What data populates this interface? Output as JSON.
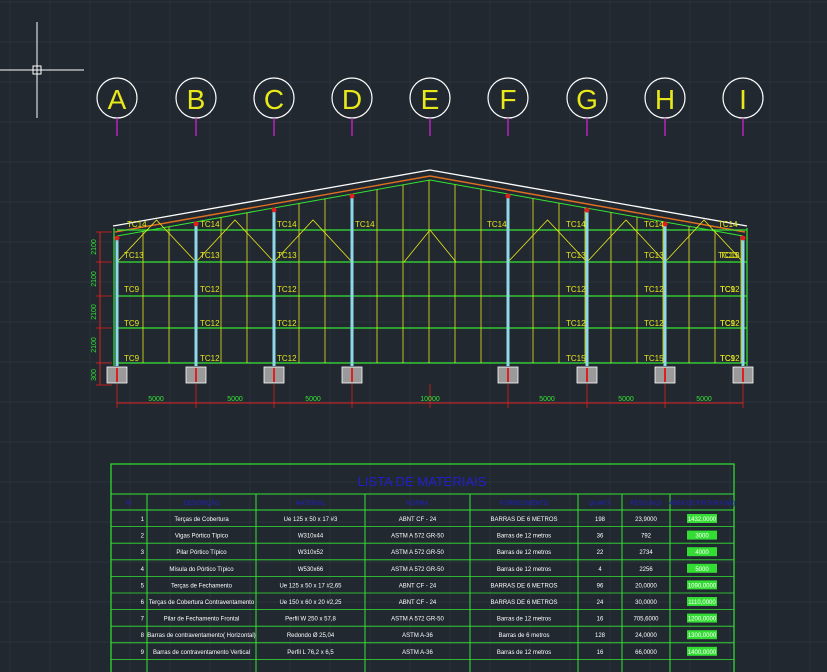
{
  "grid_axes": [
    "A",
    "B",
    "C",
    "D",
    "E",
    "F",
    "G",
    "H",
    "I"
  ],
  "member_labels": {
    "top_row": [
      "TC14",
      "TC14",
      "TC14",
      "TC14",
      "TC14",
      "TC14",
      "TC14",
      "TC14"
    ],
    "row2": [
      "TC13",
      "TC13",
      "TC13",
      "TC13",
      "TC13",
      "TC13",
      "TC13"
    ],
    "row3": [
      "TC9",
      "TC12",
      "TC12",
      "TC12",
      "TC12",
      "TC12",
      "TC9"
    ],
    "row4": [
      "TC9",
      "TC12",
      "TC12",
      "TC12",
      "TC12",
      "TC12",
      "TC9"
    ],
    "row5": [
      "TC9",
      "TC12",
      "TC12",
      "TC15",
      "TC15",
      "TC12",
      "TC9"
    ]
  },
  "vertical_dims": [
    "2100",
    "2100",
    "2100",
    "2100",
    "300"
  ],
  "span_dims": [
    "5000",
    "5000",
    "5000",
    "10000",
    "5000",
    "5000",
    "5000"
  ],
  "colors": {
    "background": "#212830",
    "grid": "#2b323c",
    "frame": "#33e533",
    "yellow": "#e8e81a",
    "column": "#8fd8e8",
    "magenta": "#e020e0",
    "red": "#e02020",
    "table_header": "#2020c8",
    "highlight": "#33dd33"
  },
  "table": {
    "title": "LISTA DE MATERIAIS",
    "headers": [
      "N°",
      "DESCRIÇÃO",
      "MATERIAL",
      "NORMA",
      "FORNECIMENTO",
      "QUANT.",
      "PESO (KG)",
      "ÁREA DE PINTURA (M²)"
    ],
    "rows": [
      {
        "n": "1",
        "desc": "Terças de Cobertura",
        "mat": "Ue 125 x 50 x 17 #3",
        "norma": "ABNT CF - 24",
        "forn": "BARRAS DE 6 METROS",
        "qtd": "198",
        "peso": "23,9000",
        "area": "1432,0000"
      },
      {
        "n": "2",
        "desc": "Vigas Pórtico Típico",
        "mat": "W310x44",
        "norma": "ASTM A 572 GR-50",
        "forn": "Barras de 12 metros",
        "qtd": "36",
        "peso": "792",
        "area": "3000"
      },
      {
        "n": "3",
        "desc": "Pilar Pórtico Típico",
        "mat": "W310x52",
        "norma": "ASTM A 572 GR-50",
        "forn": "Barras de 12 metros",
        "qtd": "22",
        "peso": "2734",
        "area": "4000"
      },
      {
        "n": "4",
        "desc": "Mísula do Pórtico Típico",
        "mat": "W530x66",
        "norma": "ASTM A 572 GR-50",
        "forn": "Barras de 12 metros",
        "qtd": "4",
        "peso": "2256",
        "area": "5000"
      },
      {
        "n": "5",
        "desc": "Terças de Fechamento",
        "mat": "Ue 125 x 50 x 17 #2,65",
        "norma": "ABNT CF - 24",
        "forn": "BARRAS DE 6 METROS",
        "qtd": "96",
        "peso": "20,0000",
        "area": "1090,0000"
      },
      {
        "n": "6",
        "desc": "Terças de Cobertura Contraventamento",
        "mat": "Ue 150 x 60 x 20 #2,25",
        "norma": "ABNT CF - 24",
        "forn": "BARRAS DE 6 METROS",
        "qtd": "24",
        "peso": "30,0000",
        "area": "1110,0000"
      },
      {
        "n": "7",
        "desc": "Pilar de Fechamento Frontal",
        "mat": "Perfil W 250 x 57,8",
        "norma": "ASTM A 572 GR-50",
        "forn": "Barras de 12 metros",
        "qtd": "16",
        "peso": "705,6000",
        "area": "1200,0000"
      },
      {
        "n": "8",
        "desc": "Barras de contraventamento( Horizontal)",
        "mat": "Redondo Ø 25,04",
        "norma": "ASTM A-36",
        "forn": "Barras de 6 metros",
        "qtd": "128",
        "peso": "24,0000",
        "area": "1300,0000"
      },
      {
        "n": "9",
        "desc": "Barras de contraventamento Vertical",
        "mat": "Perfil L 76,2 x 6,5",
        "norma": "ASTM A-36",
        "forn": "Barras de 12 metros",
        "qtd": "16",
        "peso": "66,0000",
        "area": "1400,0000"
      }
    ]
  }
}
